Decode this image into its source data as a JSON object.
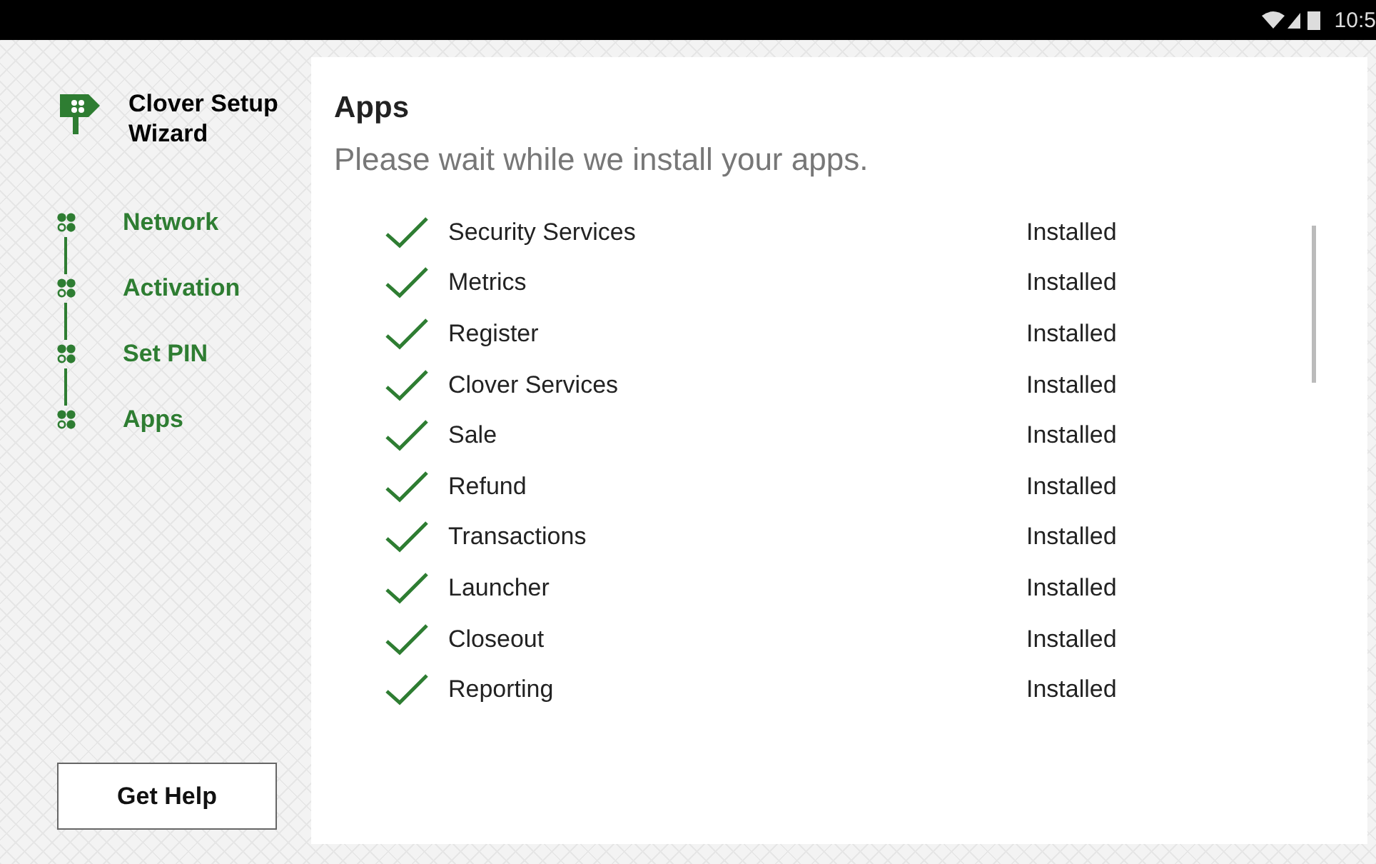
{
  "status_bar": {
    "time": "10:5"
  },
  "sidebar": {
    "title": "Clover Setup Wizard",
    "steps": [
      {
        "label": "Network"
      },
      {
        "label": "Activation"
      },
      {
        "label": "Set PIN"
      },
      {
        "label": "Apps"
      }
    ],
    "help_button": "Get Help"
  },
  "content": {
    "title": "Apps",
    "subtitle": "Please wait while we install your apps.",
    "apps": [
      {
        "name": "Security Services",
        "status": "Installed"
      },
      {
        "name": "Metrics",
        "status": "Installed"
      },
      {
        "name": "Register",
        "status": "Installed"
      },
      {
        "name": "Clover Services",
        "status": "Installed"
      },
      {
        "name": "Sale",
        "status": "Installed"
      },
      {
        "name": "Refund",
        "status": "Installed"
      },
      {
        "name": "Transactions",
        "status": "Installed"
      },
      {
        "name": "Launcher",
        "status": "Installed"
      },
      {
        "name": "Closeout",
        "status": "Installed"
      },
      {
        "name": "Reporting",
        "status": "Installed"
      }
    ]
  }
}
